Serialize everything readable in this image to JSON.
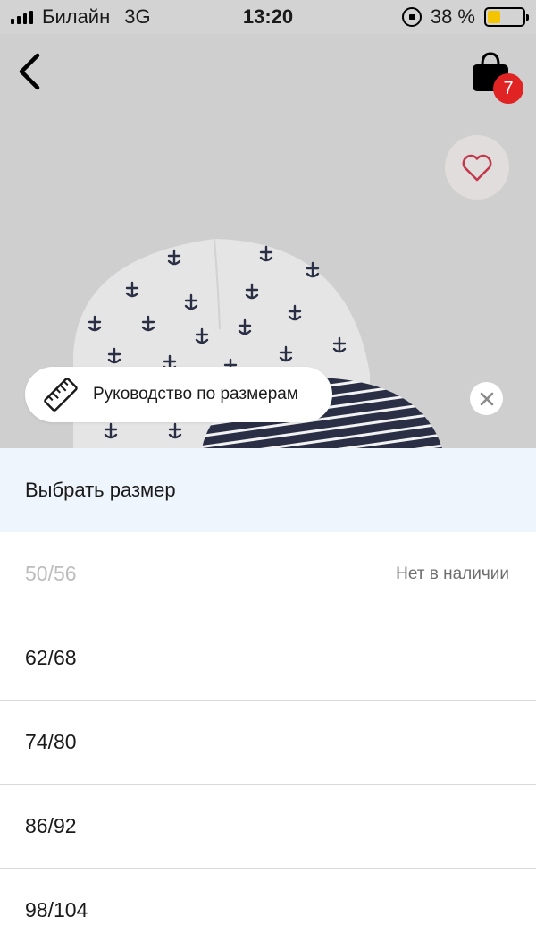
{
  "status_bar": {
    "carrier": "Билайн",
    "network": "3G",
    "time": "13:20",
    "battery": "38 %",
    "battery_level": 0.38
  },
  "header": {
    "cart_count": "7"
  },
  "size_guide": {
    "label": "Руководство по размерам"
  },
  "sheet": {
    "title": "Выбрать размер",
    "sizes": [
      {
        "label": "50/56",
        "note": "Нет в наличии",
        "available": false
      },
      {
        "label": "62/68",
        "note": "",
        "available": true
      },
      {
        "label": "74/80",
        "note": "",
        "available": true
      },
      {
        "label": "86/92",
        "note": "",
        "available": true
      },
      {
        "label": "98/104",
        "note": "",
        "available": true
      }
    ]
  },
  "colors": {
    "accent_badge": "#e02424",
    "heart": "#c0394b",
    "sheet_header_bg": "#eef5fd",
    "disabled_text": "#bdbdbd"
  }
}
